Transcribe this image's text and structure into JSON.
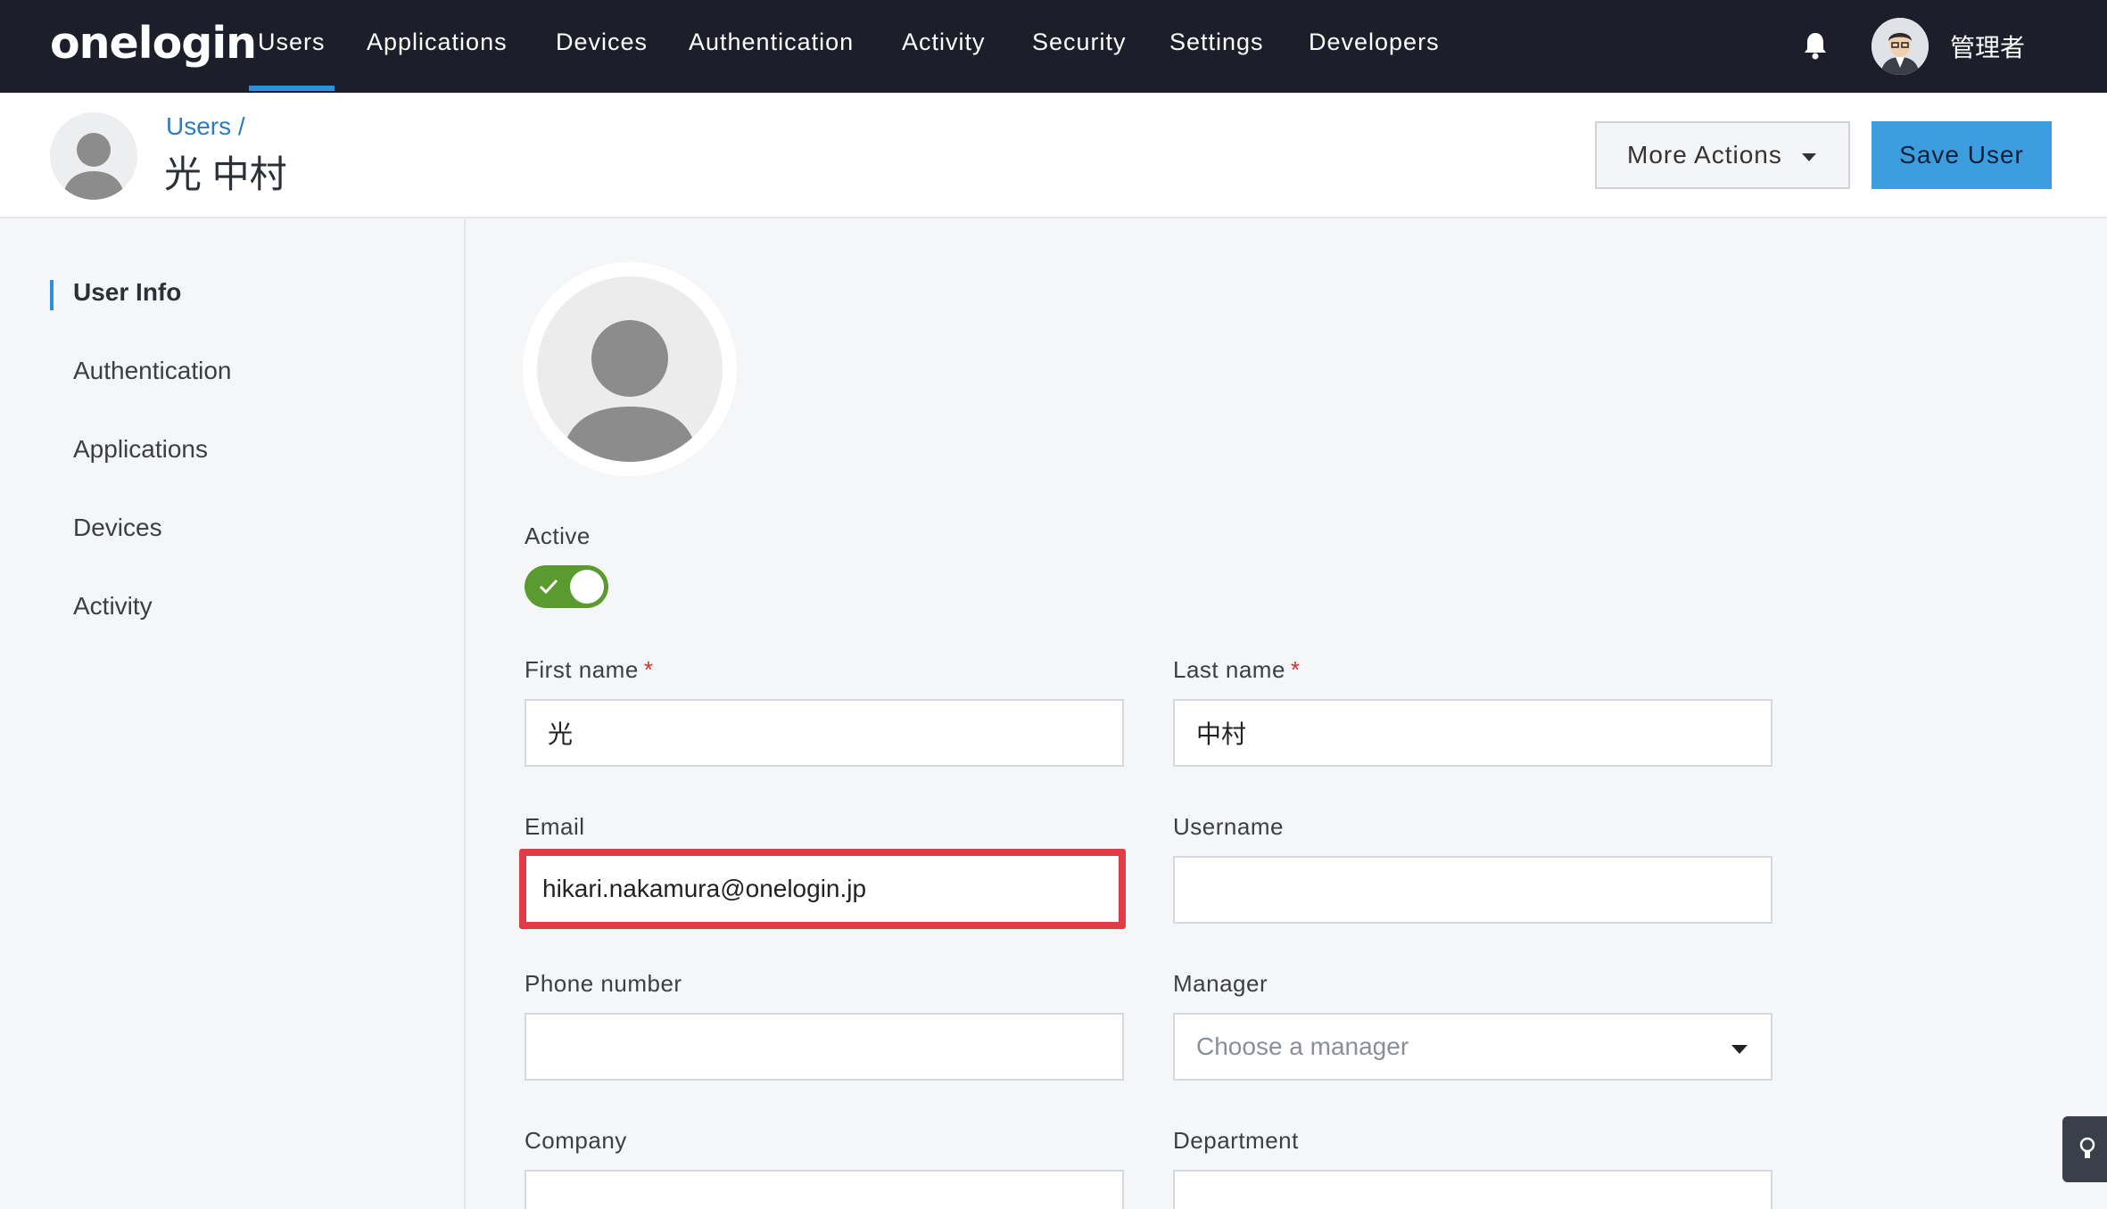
{
  "topnav": {
    "logo": "onelogin",
    "items": [
      {
        "label": "Users",
        "active": true
      },
      {
        "label": "Applications"
      },
      {
        "label": "Devices"
      },
      {
        "label": "Authentication"
      },
      {
        "label": "Activity"
      },
      {
        "label": "Security"
      },
      {
        "label": "Settings"
      },
      {
        "label": "Developers"
      }
    ],
    "admin_name": "管理者"
  },
  "header": {
    "breadcrumb": "Users /",
    "title": "光 中村",
    "more_actions_label": "More Actions",
    "save_label": "Save User"
  },
  "sidebar": {
    "items": [
      {
        "label": "User Info",
        "active": true
      },
      {
        "label": "Authentication"
      },
      {
        "label": "Applications"
      },
      {
        "label": "Devices"
      },
      {
        "label": "Activity"
      }
    ]
  },
  "form": {
    "active_label": "Active",
    "active": true,
    "first_name": {
      "label": "First name",
      "required_mark": "*",
      "value": "光"
    },
    "last_name": {
      "label": "Last name",
      "required_mark": "*",
      "value": "中村"
    },
    "email": {
      "label": "Email",
      "value": "hikari.nakamura@onelogin.jp"
    },
    "username": {
      "label": "Username",
      "value": ""
    },
    "phone": {
      "label": "Phone number",
      "value": ""
    },
    "manager": {
      "label": "Manager",
      "placeholder": "Choose a manager"
    },
    "company": {
      "label": "Company"
    },
    "department": {
      "label": "Department"
    }
  },
  "colors": {
    "nav_bg": "#1c1f2a",
    "accent": "#2f8fdb",
    "save_button": "#3c9edf",
    "toggle_on": "#5b9a2e",
    "highlight": "#e03c48"
  }
}
